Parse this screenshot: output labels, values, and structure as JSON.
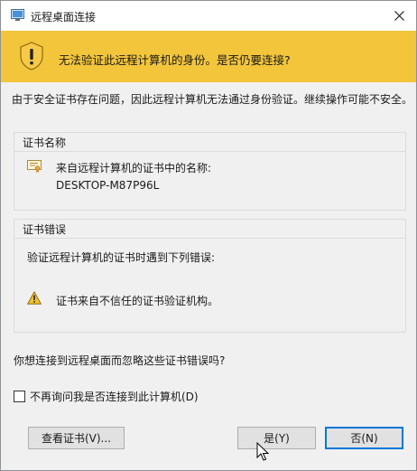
{
  "window": {
    "title": "远程桌面连接",
    "app_icon": "remote-desktop-icon",
    "close_icon": "close-icon"
  },
  "banner": {
    "message": "无法验证此远程计算机的身份。是否仍要连接?",
    "icon": "warning-shield-icon",
    "color": "#f3c53b"
  },
  "intro_text": "由于安全证书存在问题，因此远程计算机无法通过身份验证。继续操作可能不安全。",
  "cert_name_group": {
    "label": "证书名称",
    "line1": "来自远程计算机的证书中的名称:",
    "line2": "DESKTOP-M87P96L",
    "icon": "certificate-icon"
  },
  "cert_error_group": {
    "label": "证书错误",
    "intro": "验证远程计算机的证书时遇到下列错误:",
    "error": "证书来自不信任的证书验证机构。",
    "icon": "warning-icon"
  },
  "question": "你想连接到远程桌面而忽略这些证书错误吗?",
  "checkbox": {
    "label": "不再询问我是否连接到此计算机(D)",
    "checked": false
  },
  "buttons": {
    "view_cert": "查看证书(V)...",
    "yes": "是(Y)",
    "no": "否(N)"
  },
  "colors": {
    "focus_border": "#0078d7",
    "dialog_bg": "#f0f0f0"
  }
}
